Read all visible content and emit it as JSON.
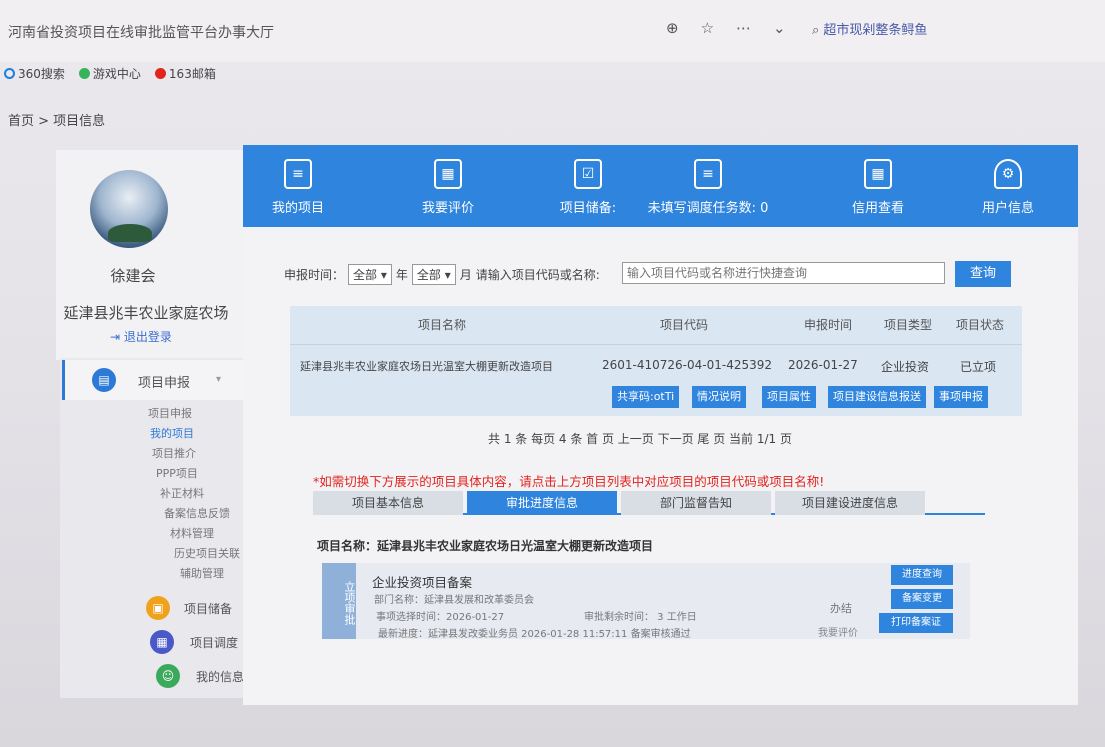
{
  "browser": {
    "window_title": "河南省投资项目在线审批监管平台办事大厅",
    "search_text": "超市现剁整条鲟鱼",
    "bookmarks": [
      "360搜索",
      "游戏中心",
      "163邮箱"
    ]
  },
  "breadcrumb": "首页 > 项目信息",
  "user": {
    "name": "徐建会",
    "org": "延津县兆丰农业家庭农场",
    "logout_label": "退出登录"
  },
  "sidebar": {
    "sections": [
      {
        "label": "项目申报",
        "sub": [
          "项目申报",
          "我的项目",
          "项目推介",
          "PPP项目",
          "补正材料",
          "备案信息反馈",
          "材料管理",
          "历史项目关联",
          "辅助管理"
        ]
      },
      {
        "label": "项目储备"
      },
      {
        "label": "项目调度"
      },
      {
        "label": "我的信息"
      }
    ]
  },
  "nav": {
    "items": [
      {
        "label": "我的项目"
      },
      {
        "label": "我要评价"
      },
      {
        "label": "项目储备:"
      },
      {
        "label": "未填写调度任务数: 0"
      },
      {
        "label": "信用查看"
      },
      {
        "label": "用户信息"
      }
    ]
  },
  "search": {
    "time_label": "申报时间：",
    "year_value": "全部",
    "year_suffix": "年",
    "month_value": "全部",
    "month_suffix": "月",
    "prompt": "请输入项目代码或名称:",
    "placeholder": "输入项目代码或名称进行快捷查询",
    "button": "查询"
  },
  "table": {
    "headers": [
      "项目名称",
      "项目代码",
      "申报时间",
      "项目类型",
      "项目状态"
    ],
    "row": {
      "name": "延津县兆丰农业家庭农场日光温室大棚更新改造项目",
      "code": "2601-410726-04-01-425392",
      "date": "2026-01-27",
      "type": "企业投资",
      "status": "已立项"
    },
    "actions": [
      "共享码:otTi",
      "情况说明",
      "项目属性",
      "项目建设信息报送",
      "事项申报"
    ]
  },
  "pager": "共 1 条  每页 4 条  首 页 上一页  下一页  尾 页  当前 1/1 页",
  "notice": "*如需切换下方展示的项目具体内容，请点击上方项目列表中对应项目的项目代码或项目名称!",
  "tabs": [
    "项目基本信息",
    "审批进度信息",
    "部门监督告知",
    "项目建设进度信息"
  ],
  "detail": {
    "project_label": "项目名称：延津县兆丰农业家庭农场日光温室大棚更新改造项目",
    "badge": "立项审批",
    "title": "企业投资项目备案",
    "dept": "部门名称：延津县发展和改革委员会",
    "start_time": "事项选择时间：2026-01-27",
    "remaining": "审批剩余时间： 3 工作日",
    "latest": "最新进度：延津县发改委业务员 2026-01-28 11:57:11 备案审核通过",
    "status": "办结",
    "rate": "我要评价",
    "buttons": [
      "进度查询",
      "备案变更",
      "打印备案证"
    ]
  }
}
